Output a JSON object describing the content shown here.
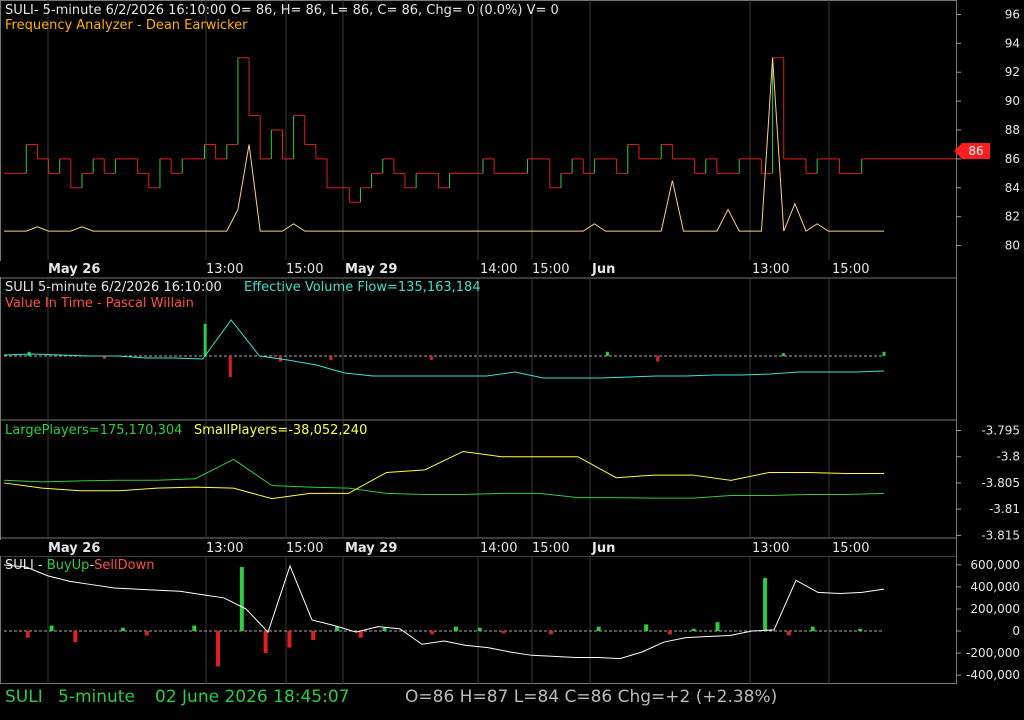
{
  "panels": {
    "p1": {
      "line1": "SULI- 5-minute 6/2/2026 16:10:00 O= 86, H= 86, L= 86, C= 86, Chg= 0 (0.0%) V= 0",
      "line2": "Frequency Analyzer - Dean Earwicker",
      "yticks": [
        "96",
        "94",
        "92",
        "90",
        "88",
        "86",
        "84",
        "82",
        "80"
      ],
      "last_price": "86"
    },
    "p2": {
      "head": "SULI 5-minute  6/2/2026 16:10:00",
      "indicator": "Effective Volume Flow=135,163,184",
      "line2": "Value In Time - Pascal Willain"
    },
    "p3": {
      "large": "LargePlayers=175,170,304",
      "small": "SmallPlayers=-38,052,240",
      "yticks": [
        "-3.795",
        "-3.8",
        "-3.805",
        "-3.81",
        "-3.815"
      ]
    },
    "p4": {
      "prefix": "SULI - ",
      "buy": "BuyUp",
      "dash": "-",
      "sell": "SellDown",
      "yticks": [
        "600,000",
        "400,000",
        "200,000",
        "0",
        "-200,000",
        "-400,000"
      ]
    }
  },
  "time_axis": {
    "labels": [
      "May 26",
      "13:00",
      "15:00",
      "May 29",
      "14:00",
      "15:00",
      "Jun",
      "13:00",
      "15:00"
    ]
  },
  "status_bar": {
    "symbol": "SULI",
    "interval": "5-minute",
    "datetime": "02 June 2026 18:45:07",
    "ohlc": "O=86 H=87 L=84 C=86 Chg=+2 (+2.38%)"
  },
  "colors": {
    "background": "#000000",
    "grid": "#3a3a3a",
    "up": "#2ecc40",
    "down": "#e02020",
    "frequency": "#ffd080",
    "flow": "#40e0d0",
    "large": "#2ecc40",
    "small": "#ffff40",
    "buy_sell_line": "#ffffff"
  },
  "chart_data": [
    {
      "type": "line",
      "title": "Frequency Analyzer - Dean Earwicker",
      "ylim": [
        79,
        97
      ],
      "series": [
        {
          "values": [
            85,
            85,
            87,
            86,
            85,
            86,
            84,
            85,
            86,
            85,
            86,
            86,
            85,
            84,
            86,
            85,
            86,
            86,
            87,
            86,
            87,
            93,
            89,
            86,
            88,
            86,
            89,
            87,
            86,
            84,
            84,
            83,
            84,
            85,
            86,
            85,
            84,
            85,
            85,
            84,
            85,
            85,
            85,
            86,
            85,
            85,
            85,
            86,
            86,
            84,
            85,
            86,
            85,
            86,
            86,
            85,
            87,
            86,
            86,
            87,
            86,
            86,
            85,
            86,
            85,
            85,
            86,
            86,
            85,
            93,
            86,
            86,
            85,
            86,
            86,
            85,
            85,
            86,
            86,
            86
          ]
        },
        {
          "values": [
            81,
            81,
            81,
            81.3,
            81,
            81,
            81,
            81.3,
            81,
            81,
            81,
            81,
            81,
            81,
            81,
            81,
            81,
            81,
            81,
            81,
            81,
            82.5,
            87,
            81,
            81,
            81,
            81.5,
            81,
            81,
            81,
            81,
            81,
            81,
            81,
            81,
            81,
            81,
            81,
            81,
            81,
            81,
            81,
            81,
            81,
            81,
            81,
            81,
            81,
            81,
            81,
            81,
            81,
            81,
            81.5,
            81,
            81,
            81,
            81,
            81,
            81,
            84.5,
            81,
            81,
            81,
            81,
            82.5,
            81,
            81,
            81,
            93,
            81,
            82.9,
            81,
            81.5,
            81,
            81,
            81,
            81,
            81,
            81
          ]
        }
      ]
    },
    {
      "type": "bar",
      "title": "Value In Time - Pascal Willain",
      "values": [
        0,
        0.3,
        0,
        0,
        -0.2,
        0,
        0,
        0,
        2.3,
        -1.5,
        0,
        -0.4,
        0,
        -0.3,
        0,
        0,
        0,
        -0.3,
        0,
        0,
        0,
        0,
        0,
        0,
        0.3,
        0,
        -0.4,
        0,
        0,
        0,
        0,
        0.2,
        0,
        0,
        0,
        0.3
      ]
    },
    {
      "type": "line",
      "ylim": [
        -3.8155,
        -3.793
      ],
      "series": [
        {
          "values": [
            -3.8045,
            -3.8048,
            -3.8046,
            -3.8045,
            -3.8045,
            -3.8042,
            -3.8005,
            -3.8055,
            -3.8058,
            -3.806,
            -3.807,
            -3.8072,
            -3.8072,
            -3.807,
            -3.807,
            -3.8078,
            -3.8078,
            -3.8079,
            -3.8079,
            -3.8074,
            -3.8074,
            -3.8072,
            -3.8072,
            -3.807
          ]
        },
        {
          "values": [
            -3.805,
            -3.806,
            -3.8065,
            -3.8065,
            -3.806,
            -3.8058,
            -3.806,
            -3.808,
            -3.807,
            -3.807,
            -3.803,
            -3.8025,
            -3.799,
            -3.8,
            -3.8,
            -3.8,
            -3.804,
            -3.8035,
            -3.8035,
            -3.8045,
            -3.803,
            -3.803,
            -3.8032,
            -3.8032
          ]
        }
      ]
    },
    {
      "type": "line",
      "ylim": [
        -480000,
        680000
      ],
      "series": [
        {
          "values": [
            600000,
            580000,
            500000,
            450000,
            420000,
            390000,
            380000,
            370000,
            360000,
            330000,
            300000,
            200000,
            -10000,
            590000,
            100000,
            50000,
            -10000,
            40000,
            20000,
            -120000,
            -90000,
            -130000,
            -150000,
            -190000,
            -220000,
            -230000,
            -240000,
            -240000,
            -250000,
            -190000,
            -100000,
            -60000,
            -50000,
            -40000,
            0,
            10000,
            460000,
            350000,
            340000,
            350000,
            380000
          ]
        },
        {
          "type": "bar",
          "values": [
            0,
            -60000,
            50000,
            -100000,
            0,
            30000,
            -40000,
            0,
            50000,
            -320000,
            580000,
            -200000,
            -150000,
            -80000,
            40000,
            -60000,
            30000,
            0,
            -30000,
            40000,
            30000,
            -20000,
            0,
            -30000,
            0,
            40000,
            0,
            60000,
            -30000,
            20000,
            80000,
            0,
            480000,
            -40000,
            40000,
            0,
            20000,
            0
          ]
        }
      ]
    }
  ]
}
